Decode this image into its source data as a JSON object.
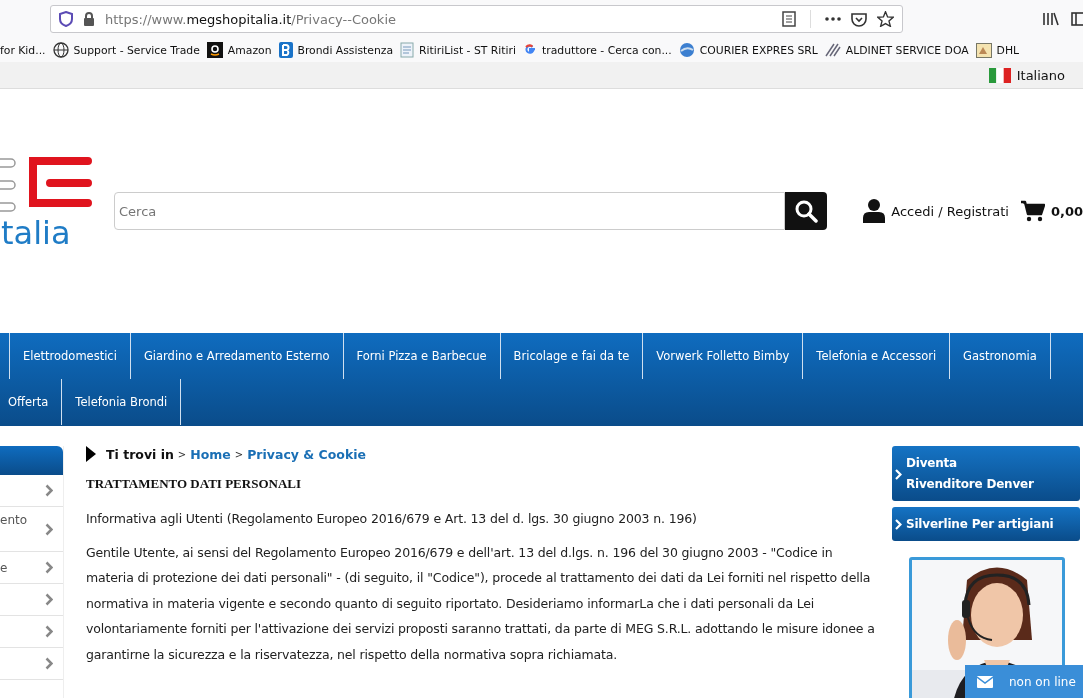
{
  "browser": {
    "url_host": "https://www.megshopitalia.it",
    "url_path": "/Privacy--Cookie",
    "bookmarks": [
      {
        "label": "for Kid...",
        "kind": "none"
      },
      {
        "label": "Support - Service Trade",
        "kind": "globe"
      },
      {
        "label": "Amazon",
        "kind": "amazon"
      },
      {
        "label": "Brondi Assistenza",
        "kind": "brondi"
      },
      {
        "label": "RitiriList - ST Ritiri",
        "kind": "doc"
      },
      {
        "label": "traduttore - Cerca con...",
        "kind": "google"
      },
      {
        "label": "COURIER EXPRES SRL",
        "kind": "globe2"
      },
      {
        "label": "ALDINET SERVICE DOA",
        "kind": "aldinet"
      },
      {
        "label": "DHL",
        "kind": "dhl"
      }
    ]
  },
  "language": "Italiano",
  "header": {
    "logo_text": "talia",
    "search": {
      "placeholder": "Cerca"
    },
    "account": "Accedi / Registrati",
    "cart_total": "0,00"
  },
  "nav": {
    "rows": [
      [
        "Elettrodomestici",
        "Giardino e Arredamento Esterno",
        "Forni Pizza e Barbecue",
        "Bricolage e fai da te",
        "Vorwerk Folletto Bimby",
        "Telefonia e Accessori",
        "Gastronomia"
      ],
      [
        "Offerta",
        "Telefonia Brondi"
      ]
    ]
  },
  "sidebar": {
    "items": [
      {
        "kind": "plain"
      },
      {
        "kind": "labeled",
        "label": "ento"
      },
      {
        "kind": "labeled",
        "label": "e"
      },
      {
        "kind": "plain"
      },
      {
        "kind": "plain"
      },
      {
        "kind": "plain"
      }
    ]
  },
  "breadcrumb": {
    "lead": "Ti trovi in",
    "links": [
      {
        "separator": ">",
        "label": "Home"
      },
      {
        "separator": ">",
        "label": "Privacy & Cookie"
      }
    ]
  },
  "article": {
    "title": "TRATTAMENTO DATI PERSONALI",
    "paragraphs": [
      "Informativa agli Utenti (Regolamento Europeo 2016/679 e Art. 13 del d. lgs. 30 giugno 2003 n. 196)",
      "Gentile Utente, ai sensi del Regolamento Europeo 2016/679 e dell'art. 13 del d.lgs. n. 196 del 30 giugno 2003 - \"Codice in materia di protezione dei dati personali\" - (di seguito, il \"Codice\"), procede al trattamento dei dati da Lei forniti nel rispetto della normativa in materia vigente e secondo quanto di seguito riportato. Desideriamo informarLa che i dati personali da Lei volontariamente forniti per l'attivazione dei servizi proposti saranno trattati, da parte di MEG S.R.L. adottando le misure idonee a garantirne la sicurezza e la riservatezza, nel rispetto della normativa sopra richiamata."
    ]
  },
  "side_buttons": [
    "Diventa Rivenditore Denver",
    "Silverline Per artigiani"
  ],
  "chat": {
    "status": "non on line"
  }
}
